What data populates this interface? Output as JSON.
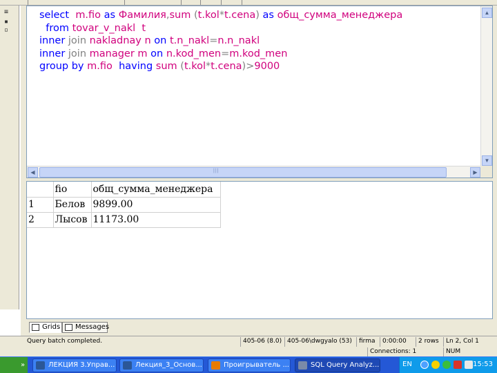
{
  "editor": {
    "lines": [
      [
        {
          "t": "select  ",
          "c": "kw"
        },
        {
          "t": "m.fio ",
          "c": "st"
        },
        {
          "t": "as ",
          "c": "kw"
        },
        {
          "t": "Фамилия",
          "c": "st"
        },
        {
          "t": ",",
          "c": "gr"
        },
        {
          "t": "sum ",
          "c": "fn"
        },
        {
          "t": "(",
          "c": "gr"
        },
        {
          "t": "t.kol",
          "c": "st"
        },
        {
          "t": "*",
          "c": "gr"
        },
        {
          "t": "t.cena",
          "c": "st"
        },
        {
          "t": ") ",
          "c": "gr"
        },
        {
          "t": "as ",
          "c": "kw"
        },
        {
          "t": "общ_сумма_менеджера",
          "c": "st"
        }
      ],
      [
        {
          "t": "  from ",
          "c": "kw"
        },
        {
          "t": "tovar_v_nakl  t",
          "c": "st"
        }
      ],
      [
        {
          "t": "inner ",
          "c": "kw"
        },
        {
          "t": "join ",
          "c": "gr"
        },
        {
          "t": "nakladnay n ",
          "c": "st"
        },
        {
          "t": "on ",
          "c": "kw"
        },
        {
          "t": "t.n_nakl",
          "c": "st"
        },
        {
          "t": "=",
          "c": "gr"
        },
        {
          "t": "n.n_nakl",
          "c": "st"
        }
      ],
      [
        {
          "t": "inner ",
          "c": "kw"
        },
        {
          "t": "join ",
          "c": "gr"
        },
        {
          "t": "manager m ",
          "c": "st"
        },
        {
          "t": "on ",
          "c": "kw"
        },
        {
          "t": "n.kod_men",
          "c": "st"
        },
        {
          "t": "=",
          "c": "gr"
        },
        {
          "t": "m.kod_men",
          "c": "st"
        }
      ],
      [
        {
          "t": "group by ",
          "c": "kw"
        },
        {
          "t": "m.fio  ",
          "c": "st"
        },
        {
          "t": "having ",
          "c": "kw"
        },
        {
          "t": "sum ",
          "c": "fn"
        },
        {
          "t": "(",
          "c": "gr"
        },
        {
          "t": "t.kol",
          "c": "st"
        },
        {
          "t": "*",
          "c": "gr"
        },
        {
          "t": "t.cena",
          "c": "st"
        },
        {
          "t": ")",
          "c": "gr"
        },
        {
          "t": ">",
          "c": "gr"
        },
        {
          "t": "9000",
          "c": "st"
        }
      ]
    ]
  },
  "results": {
    "columns": [
      "fio",
      "общ_сумма_менеджера"
    ],
    "rows": [
      {
        "num": "1",
        "fio": "Белов",
        "sum": "9899.00"
      },
      {
        "num": "2",
        "fio": "Лысов",
        "sum": "11173.00"
      }
    ]
  },
  "tabs": {
    "grids_label": "Grids",
    "messages_label": "Messages"
  },
  "status": {
    "main": "Query batch completed.",
    "server": "405-06 (8.0)",
    "user": "405-06\\dwgyalo (53)",
    "database": "firma",
    "time": "0:00:00",
    "rows": "2 rows",
    "position": "Ln 2, Col 1",
    "connections": "Connections: 1",
    "num": "NUM"
  },
  "taskbar": {
    "tasks": [
      {
        "label": "ЛЕКЦИЯ 3.Управ...",
        "color": "#2b5797"
      },
      {
        "label": "Лекция_3_Основ...",
        "color": "#2b5797"
      },
      {
        "label": "Проигрыватель ...",
        "color": "#e87b00"
      },
      {
        "label": "SQL Query Analyz...",
        "color": "#7a8aa8"
      }
    ],
    "lang": "EN",
    "clock": "15:53"
  }
}
